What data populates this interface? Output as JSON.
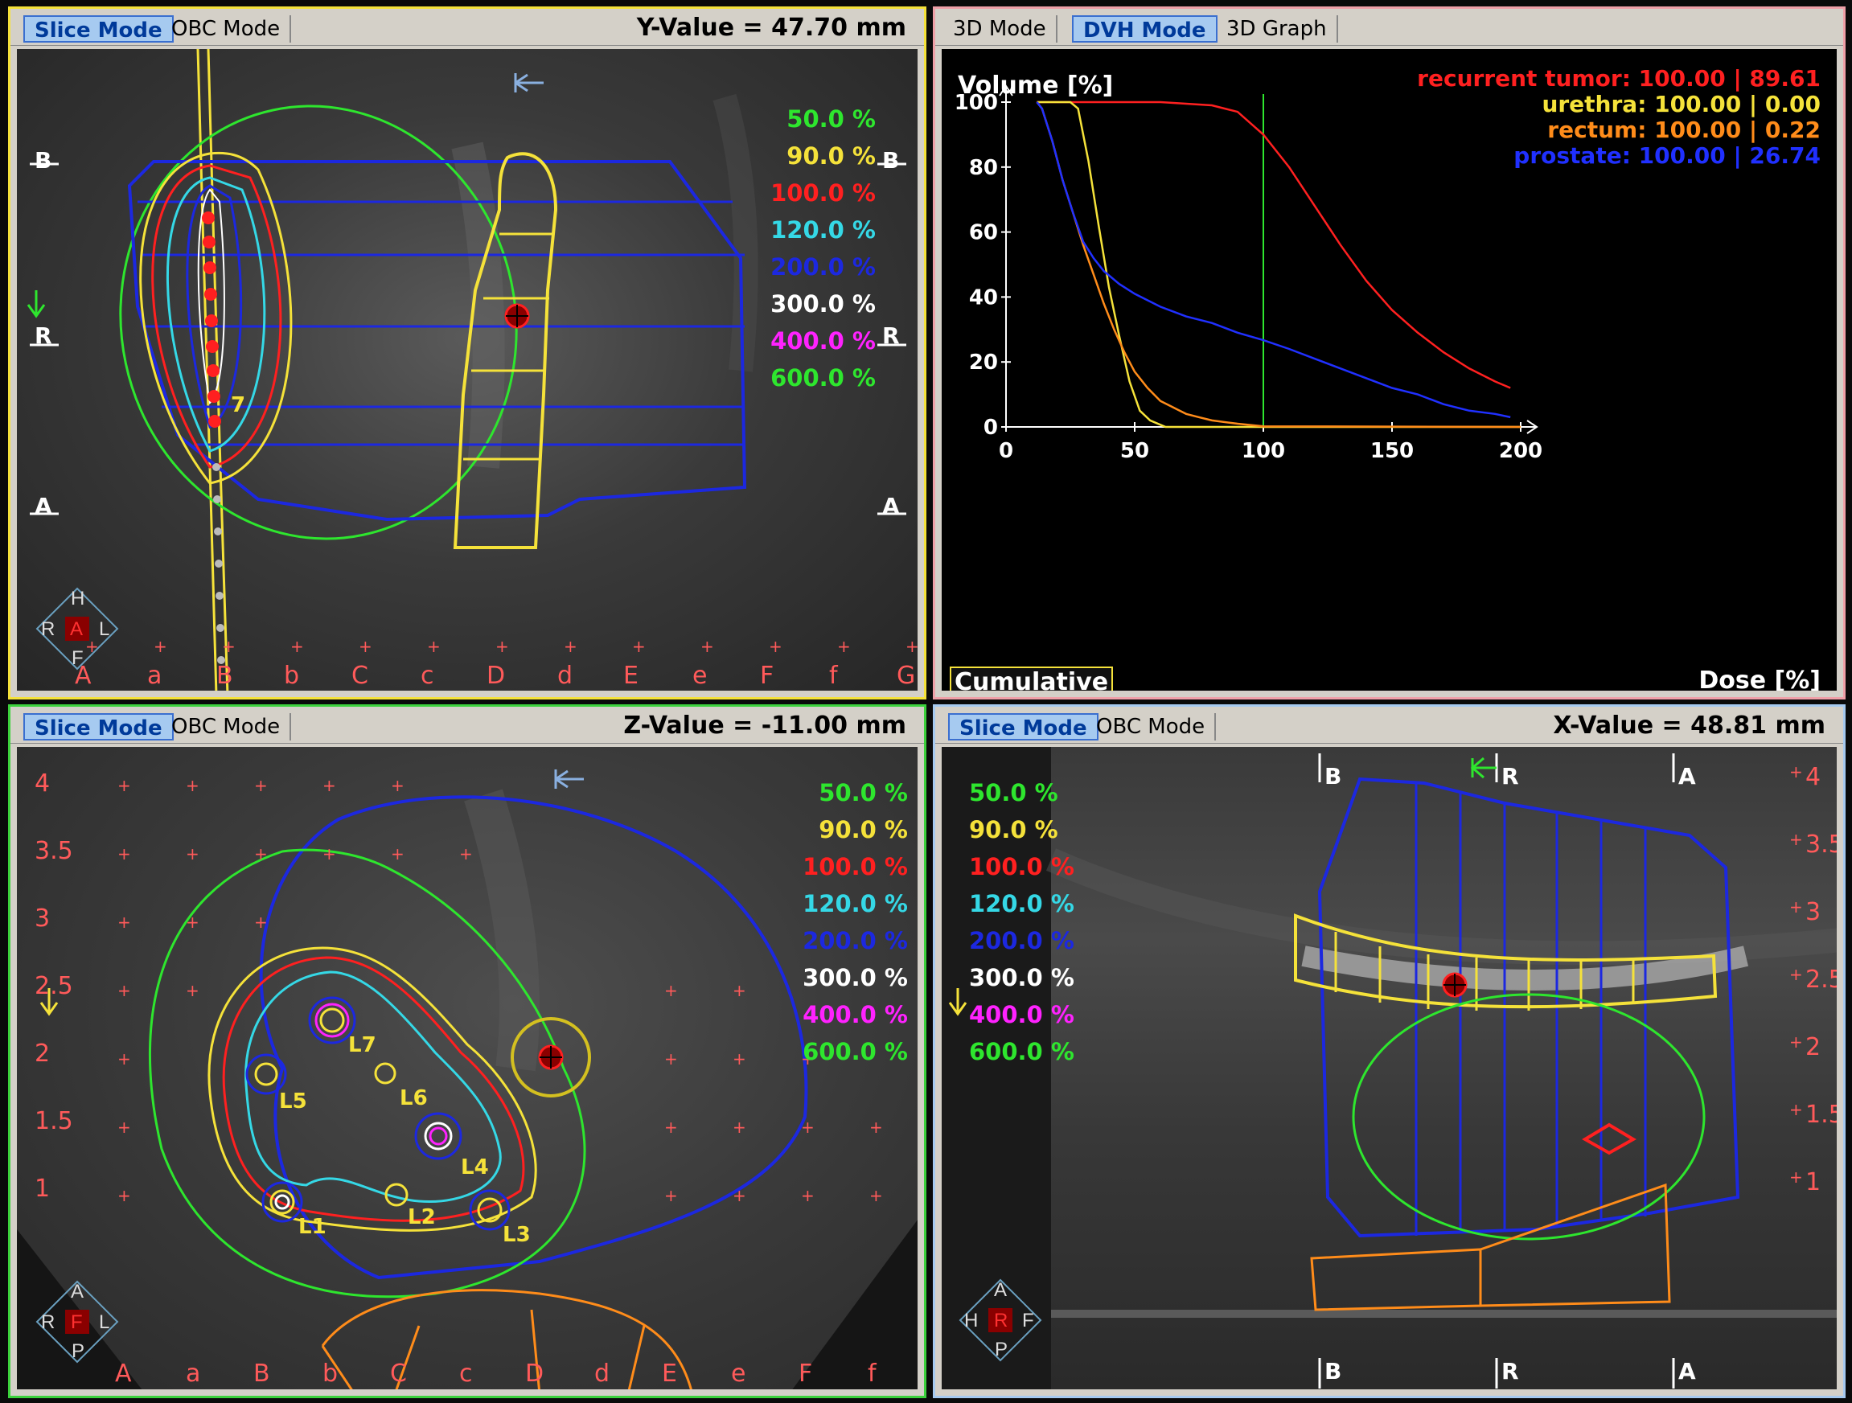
{
  "panels": {
    "top_left": {
      "tabs": [
        "Slice Mode",
        "OBC Mode"
      ],
      "active_tab": "Slice Mode",
      "value_readout": "Y-Value = 47.70 mm",
      "border_color": "#f5e23a",
      "ref_labels": [
        "B",
        "R",
        "A",
        "B",
        "R",
        "A"
      ],
      "catheter_label": "7",
      "bottom_letters": [
        "A",
        "a",
        "B",
        "b",
        "C",
        "c",
        "D",
        "d",
        "E",
        "e",
        "F",
        "f",
        "G"
      ],
      "compass": [
        "H",
        "R",
        "A",
        "L",
        "F"
      ]
    },
    "top_right": {
      "tabs": [
        "3D Mode",
        "DVH Mode",
        "3D Graph"
      ],
      "active_tab": "DVH Mode",
      "border_color": "#f0a0a8"
    },
    "bottom_left": {
      "tabs": [
        "Slice Mode",
        "OBC Mode"
      ],
      "active_tab": "Slice Mode",
      "value_readout": "Z-Value = -11.00 mm",
      "border_color": "#3cd23c",
      "row_numbers": [
        "4",
        "3.5",
        "3",
        "2.5",
        "2",
        "1.5",
        "1"
      ],
      "catheter_labels": [
        "L7",
        "L5",
        "L6",
        "L4",
        "L1",
        "L2",
        "L3"
      ],
      "bottom_letters": [
        "A",
        "a",
        "B",
        "b",
        "C",
        "c",
        "D",
        "d",
        "E",
        "e",
        "F",
        "f"
      ],
      "compass": [
        "A",
        "R",
        "F",
        "L",
        "P"
      ]
    },
    "bottom_right": {
      "tabs": [
        "Slice Mode",
        "OBC Mode"
      ],
      "active_tab": "Slice Mode",
      "value_readout": "X-Value = 48.81 mm",
      "border_color": "#a6caf0",
      "ref_labels_top": [
        "B",
        "R",
        "A"
      ],
      "ref_labels_bottom": [
        "B",
        "R",
        "A"
      ],
      "row_numbers": [
        "4",
        "3.5",
        "3",
        "2.5",
        "2",
        "1.5",
        "1"
      ],
      "compass": [
        "A",
        "H",
        "R",
        "F",
        "P"
      ]
    }
  },
  "isodose_legend": [
    {
      "label": "50.0 %",
      "color": "#2ee62e"
    },
    {
      "label": "90.0 %",
      "color": "#f5e23a"
    },
    {
      "label": "100.0 %",
      "color": "#ff2020"
    },
    {
      "label": "120.0 %",
      "color": "#35d8e6"
    },
    {
      "label": "200.0 %",
      "color": "#1c28e0"
    },
    {
      "label": "300.0 %",
      "color": "#ffffff"
    },
    {
      "label": "400.0 %",
      "color": "#ff22ff"
    },
    {
      "label": "600.0 %",
      "color": "#2ee62e"
    }
  ],
  "dvh": {
    "y_title": "Volume [%]",
    "x_title": "Dose [%]",
    "mode_label": "Cumulative",
    "legend": [
      {
        "text": "recurrent tumor: 100.00 | 89.61",
        "color": "#ff2020"
      },
      {
        "text": "urethra: 100.00 | 0.00",
        "color": "#f5e23a"
      },
      {
        "text": "rectum: 100.00 | 0.22",
        "color": "#ff8c1a"
      },
      {
        "text": "prostate: 100.00 | 26.74",
        "color": "#2030ff"
      }
    ]
  },
  "chart_data": {
    "type": "line",
    "title": "",
    "xlabel": "Dose [%]",
    "ylabel": "Volume [%]",
    "xlim": [
      0,
      200
    ],
    "ylim": [
      0,
      100
    ],
    "x_ticks": [
      "0",
      "50",
      "100",
      "150",
      "200"
    ],
    "y_ticks": [
      "0",
      "20",
      "40",
      "60",
      "80",
      "100"
    ],
    "reference_line_x": 100,
    "series": [
      {
        "name": "recurrent tumor",
        "color": "#ff2020",
        "points": [
          [
            12,
            100
          ],
          [
            60,
            100
          ],
          [
            80,
            99
          ],
          [
            90,
            97
          ],
          [
            100,
            90
          ],
          [
            110,
            80
          ],
          [
            120,
            68
          ],
          [
            130,
            56
          ],
          [
            140,
            45
          ],
          [
            150,
            36
          ],
          [
            160,
            29
          ],
          [
            170,
            23
          ],
          [
            180,
            18
          ],
          [
            190,
            14
          ],
          [
            196,
            12
          ]
        ]
      },
      {
        "name": "urethra",
        "color": "#f5e23a",
        "points": [
          [
            12,
            100
          ],
          [
            25,
            100
          ],
          [
            28,
            98
          ],
          [
            32,
            82
          ],
          [
            36,
            62
          ],
          [
            40,
            43
          ],
          [
            44,
            28
          ],
          [
            48,
            14
          ],
          [
            52,
            5
          ],
          [
            56,
            2
          ],
          [
            62,
            0
          ],
          [
            100,
            0
          ],
          [
            200,
            0
          ]
        ]
      },
      {
        "name": "rectum",
        "color": "#ff8c1a",
        "points": [
          [
            12,
            100
          ],
          [
            14,
            98
          ],
          [
            18,
            88
          ],
          [
            22,
            76
          ],
          [
            26,
            66
          ],
          [
            30,
            56
          ],
          [
            34,
            47
          ],
          [
            38,
            38
          ],
          [
            42,
            30
          ],
          [
            46,
            23
          ],
          [
            50,
            17
          ],
          [
            55,
            12
          ],
          [
            60,
            8
          ],
          [
            65,
            6
          ],
          [
            70,
            4
          ],
          [
            75,
            3
          ],
          [
            80,
            2
          ],
          [
            90,
            1
          ],
          [
            100,
            0.2
          ],
          [
            200,
            0
          ]
        ]
      },
      {
        "name": "prostate",
        "color": "#2030ff",
        "points": [
          [
            12,
            100
          ],
          [
            14,
            98
          ],
          [
            18,
            88
          ],
          [
            22,
            76
          ],
          [
            26,
            66
          ],
          [
            30,
            57
          ],
          [
            34,
            52
          ],
          [
            38,
            48
          ],
          [
            44,
            44
          ],
          [
            50,
            41
          ],
          [
            60,
            37
          ],
          [
            70,
            34
          ],
          [
            80,
            32
          ],
          [
            90,
            29
          ],
          [
            100,
            26.7
          ],
          [
            110,
            24
          ],
          [
            120,
            21
          ],
          [
            130,
            18
          ],
          [
            140,
            15
          ],
          [
            150,
            12
          ],
          [
            160,
            10
          ],
          [
            170,
            7
          ],
          [
            180,
            5
          ],
          [
            190,
            4
          ],
          [
            196,
            3
          ]
        ]
      }
    ]
  }
}
